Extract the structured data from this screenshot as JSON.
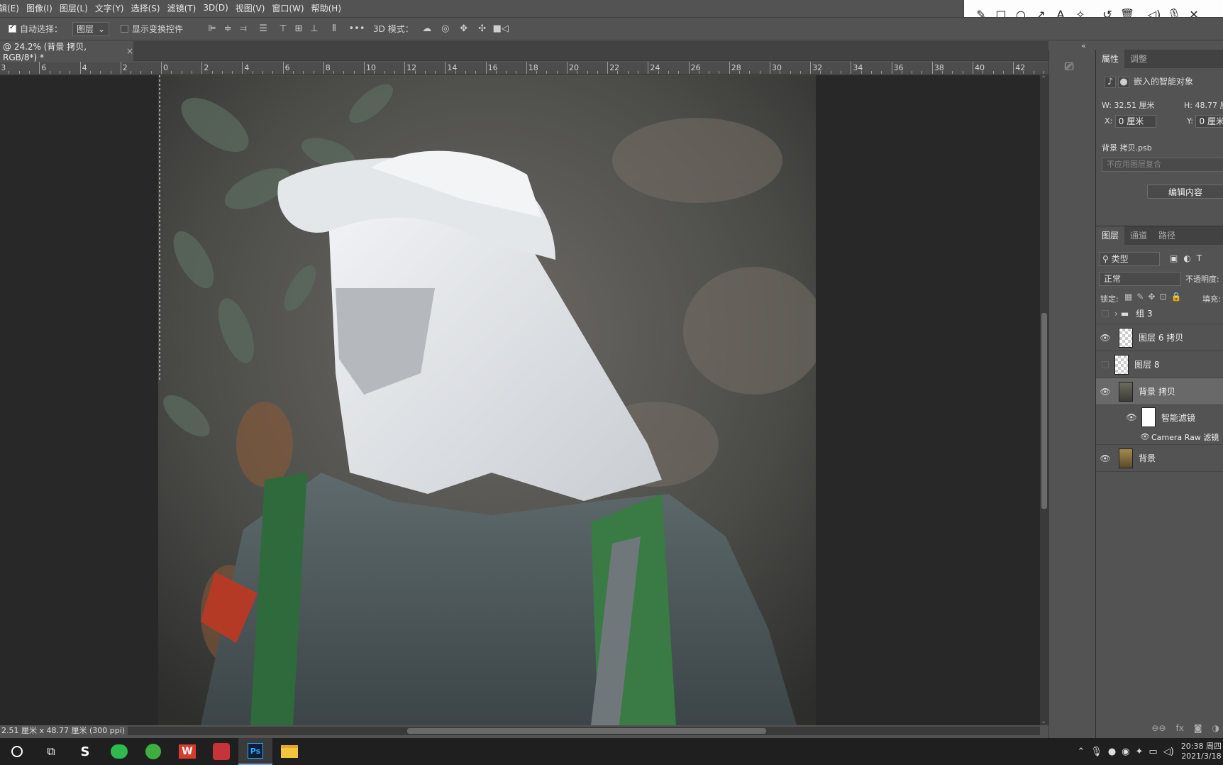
{
  "menubar": {
    "items": [
      "辑(E)",
      "图像(I)",
      "图层(L)",
      "文字(Y)",
      "选择(S)",
      "滤镜(T)",
      "3D(D)",
      "视图(V)",
      "窗口(W)",
      "帮助(H)"
    ]
  },
  "annotation_toolbar": {
    "tools": [
      "pencil-icon",
      "rectangle-icon",
      "circle-icon",
      "arrow-icon",
      "text-icon",
      "highlighter-icon",
      "undo-icon",
      "trash-icon",
      "speaker-icon",
      "microphone-icon",
      "close-icon"
    ]
  },
  "options": {
    "auto_select_label": "自动选择：",
    "auto_select_checked": true,
    "auto_select_target": "图层",
    "show_transform_label": "显示变换控件",
    "show_transform_checked": false,
    "more_label": "•••",
    "mode_3d_label": "3D 模式："
  },
  "document": {
    "tab_title": "@ 24.2% (背景 拷贝, RGB/8*) *",
    "close_label": "×",
    "status": "2.51 厘米 x 48.77 厘米 (300 ppi)",
    "status_arrow": "›"
  },
  "ruler": {
    "labels": [
      "3",
      "6",
      "4",
      "2",
      "0",
      "2",
      "4",
      "6",
      "8",
      "10",
      "12",
      "14",
      "16",
      "18",
      "20",
      "22",
      "24",
      "26",
      "28",
      "30",
      "32",
      "34",
      "36",
      "38",
      "40",
      "42"
    ]
  },
  "properties": {
    "tabs": [
      "属性",
      "调整"
    ],
    "type_label": "嵌入的智能对象",
    "w_label": "W:",
    "w_value": "32.51 厘米",
    "h_label": "H:",
    "h_value": "48.77 厘",
    "x_label": "X:",
    "x_value": "0 厘米",
    "y_label": "Y:",
    "y_value": "0 厘米",
    "filename": "背景 拷贝.psb",
    "comp_placeholder": "不应用图层复合",
    "edit_button": "编辑内容"
  },
  "layers_panel": {
    "tabs": [
      "图层",
      "通道",
      "路径"
    ],
    "filter_kind": "类型",
    "blend_mode": "正常",
    "opacity_label": "不透明度:",
    "lock_label": "锁定:",
    "fill_label": "填充:",
    "layers": [
      {
        "name": "组 3",
        "type": "group",
        "visible": false
      },
      {
        "name": "图层 6 拷贝",
        "type": "transparent",
        "visible": true
      },
      {
        "name": "图层 8",
        "type": "transparent",
        "visible": false
      },
      {
        "name": "背景 拷贝",
        "type": "smart",
        "visible": true,
        "selected": true
      },
      {
        "name": "智能滤镜",
        "type": "filter-mask",
        "visible": true
      },
      {
        "name": "Camera Raw 滤镜",
        "type": "filter",
        "visible": true
      },
      {
        "name": "背景",
        "type": "photo",
        "visible": true
      }
    ]
  },
  "taskbar": {
    "apps": [
      "cortana-icon",
      "task-view-icon",
      "app-s-icon",
      "wechat-icon",
      "app-green-icon",
      "wps-icon",
      "app-red-icon",
      "photoshop-icon",
      "file-explorer-icon"
    ],
    "ps_label": "Ps",
    "wps_label": "W",
    "time": "20:38 周四",
    "date": "2021/3/18"
  }
}
